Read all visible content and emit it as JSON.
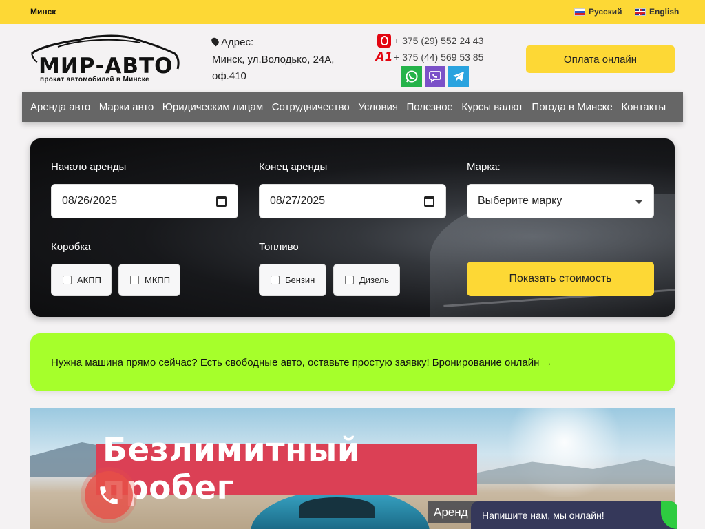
{
  "topbar": {
    "city": "Минск",
    "languages": [
      {
        "label": "Русский",
        "flag": "flag-ru-icon"
      },
      {
        "label": "English",
        "flag": "flag-en-icon"
      }
    ]
  },
  "header": {
    "logo": {
      "brand": "МИР-АВТО",
      "tagline": "прокат автомобилей в Минске"
    },
    "address": {
      "label": "Адрес:",
      "line1": "Минск, ул.Володько, 24А,",
      "line2": "оф.410"
    },
    "phones": [
      {
        "operator": "mts-icon",
        "number": "+ 375 (29) 552 24 43"
      },
      {
        "operator": "a1-icon",
        "number": "+ 375 (44) 569 53 85"
      }
    ],
    "messengers": [
      "whatsapp-icon",
      "viber-icon",
      "telegram-icon"
    ],
    "pay_button": "Оплата онлайн"
  },
  "nav": {
    "items": [
      "Аренда авто",
      "Марки авто",
      "Юридическим лицам",
      "Сотрудничество",
      "Условия",
      "Полезное",
      "Курсы валют",
      "Погода в Минске",
      "Контакты"
    ]
  },
  "search": {
    "start_label": "Начало аренды",
    "start_value": "08/26/2025",
    "end_label": "Конец аренды",
    "end_value": "08/27/2025",
    "brand_label": "Марка:",
    "brand_value": "Выберите марку",
    "gearbox_label": "Коробка",
    "gearbox_options": [
      "АКПП",
      "МКПП"
    ],
    "fuel_label": "Топливо",
    "fuel_options": [
      "Бензин",
      "Дизель"
    ],
    "submit": "Показать стоимость"
  },
  "banner": {
    "text": "Нужна машина прямо сейчас? Есть свободные авто, оставьте простую заявку! Бронирование онлайн →"
  },
  "hero": {
    "title": "Безлимитный пробег",
    "subtitle": "Аренд"
  },
  "chat": {
    "text": "Напишите нам, мы онлайн!"
  },
  "colors": {
    "accent": "#fdd835",
    "nav_bg": "#666666",
    "banner": "#a6ff2b",
    "hero_title_bg": "#db4055",
    "chat_bg": "#35385a"
  }
}
